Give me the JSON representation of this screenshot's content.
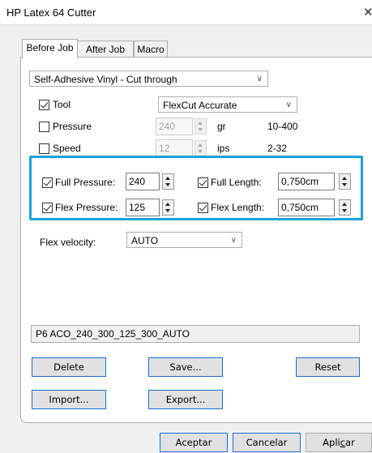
{
  "window": {
    "title": "HP Latex 64 Cutter",
    "close_glyph": "✕"
  },
  "tabs": [
    {
      "label": "Before Job",
      "active": true
    },
    {
      "label": "After Job",
      "active": false
    },
    {
      "label": "Macro",
      "active": false
    }
  ],
  "media_preset": {
    "value": "Self-Adhesive Vinyl - Cut through"
  },
  "tool": {
    "label": "Tool",
    "checked": true,
    "value": "FlexCut Accurate"
  },
  "pressure": {
    "label": "Pressure",
    "checked": false,
    "value": "240",
    "unit": "gr",
    "range": "10-400"
  },
  "speed": {
    "label": "Speed",
    "checked": false,
    "value": "12",
    "unit": "ips",
    "range": "2-32"
  },
  "flexcut": {
    "full_pressure": {
      "label": "Full Pressure:",
      "checked": true,
      "value": "240"
    },
    "flex_pressure": {
      "label": "Flex Pressure:",
      "checked": true,
      "value": "125"
    },
    "full_length": {
      "label": "Full Length:",
      "checked": true,
      "value": "0,750cm"
    },
    "flex_length": {
      "label": "Flex Length:",
      "checked": true,
      "value": "0,750cm"
    },
    "highlight_color": "#1aa2db"
  },
  "flex_velocity": {
    "label": "Flex velocity:",
    "value": "AUTO"
  },
  "preset_name": {
    "value": "P6 ACO_240_300_125_300_AUTO"
  },
  "buttons": {
    "delete": "Delete",
    "save": "Save...",
    "reset": "Reset",
    "import": "Import...",
    "export": "Export..."
  },
  "footer": {
    "accept": "Aceptar",
    "cancel": "Cancelar",
    "apply_prefix": "Apli",
    "apply_accel": "c",
    "apply_suffix": "ar"
  },
  "colors": {
    "accent_blue": "#1a6fd1",
    "panel_bg": "#ffffff",
    "window_bg": "#f0f0f0"
  }
}
